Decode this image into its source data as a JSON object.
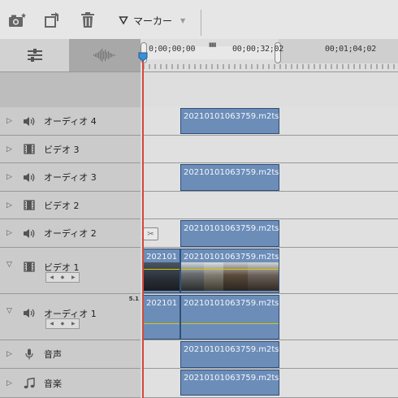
{
  "toolbar": {
    "marker_label": "マーカー",
    "icons": [
      "camera-icon",
      "export-icon",
      "trash-icon",
      "marker-icon"
    ]
  },
  "ruler": {
    "timecodes": [
      "0;00;00;00",
      "00;00;32;02",
      "00;01;04;02"
    ]
  },
  "tracks": [
    {
      "name": "オーディオ 4",
      "type": "audio",
      "clip": "20210101063759.m2ts"
    },
    {
      "name": "ビデオ 3",
      "type": "video",
      "clip": ""
    },
    {
      "name": "オーディオ 3",
      "type": "audio",
      "clip": "20210101063759.m2ts"
    },
    {
      "name": "ビデオ 2",
      "type": "video",
      "clip": ""
    },
    {
      "name": "オーディオ 2",
      "type": "audio",
      "clip": "20210101063759.m2ts"
    },
    {
      "name": "ビデオ 1",
      "type": "video",
      "clip_a": "202101",
      "clip": "20210101063759.m2ts"
    },
    {
      "name": "オーディオ 1",
      "type": "audio",
      "badge": "5.1",
      "clip_a": "202101",
      "clip": "20210101063759.m2ts"
    },
    {
      "name": "音声",
      "type": "voice",
      "clip": "20210101063759.m2ts"
    },
    {
      "name": "音楽",
      "type": "music",
      "clip": "20210101063759.m2ts"
    }
  ],
  "colors": {
    "clip_fill": "#6c8db8",
    "playhead": "#d24a3a",
    "volume_line": "#d8c800"
  }
}
